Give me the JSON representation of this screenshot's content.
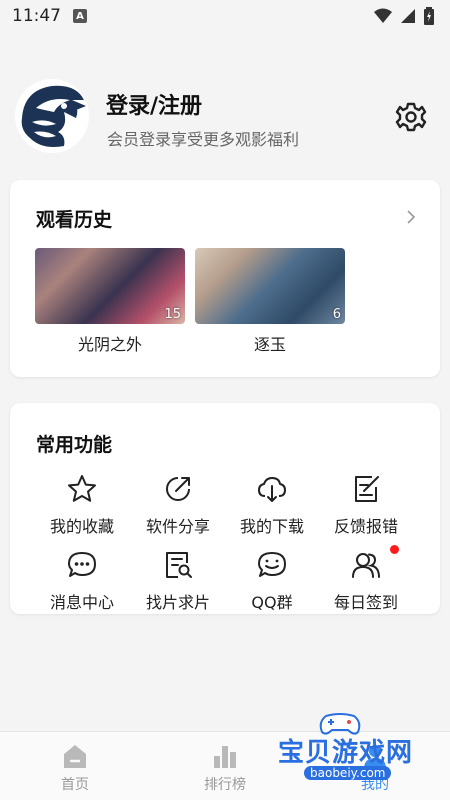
{
  "status_bar": {
    "time": "11:47",
    "notification_letter": "A"
  },
  "profile": {
    "title": "登录/注册",
    "subtitle": "会员登录享受更多观影福利"
  },
  "history": {
    "title": "观看历史",
    "items": [
      {
        "title": "光阴之外",
        "episode": "15"
      },
      {
        "title": "逐玉",
        "episode": "6"
      }
    ]
  },
  "features": {
    "title": "常用功能",
    "items": [
      {
        "label": "我的收藏",
        "icon": "star-icon"
      },
      {
        "label": "软件分享",
        "icon": "share-icon"
      },
      {
        "label": "我的下载",
        "icon": "cloud-download-icon"
      },
      {
        "label": "反馈报错",
        "icon": "feedback-edit-icon"
      },
      {
        "label": "消息中心",
        "icon": "chat-bubble-icon"
      },
      {
        "label": "找片求片",
        "icon": "search-document-icon"
      },
      {
        "label": "QQ群",
        "icon": "group-chat-icon"
      },
      {
        "label": "每日签到",
        "icon": "users-icon"
      }
    ]
  },
  "bottom_nav": {
    "items": [
      {
        "label": "首页",
        "icon": "home-icon"
      },
      {
        "label": "排行榜",
        "icon": "ranking-icon"
      },
      {
        "label": "我的",
        "icon": "profile-icon"
      }
    ]
  },
  "watermark": {
    "title": "宝贝游戏网",
    "url": "baobeiy.com"
  },
  "colors": {
    "accent": "#3a8df0",
    "badge": "#ff1a1a",
    "background": "#f4f4f5"
  }
}
